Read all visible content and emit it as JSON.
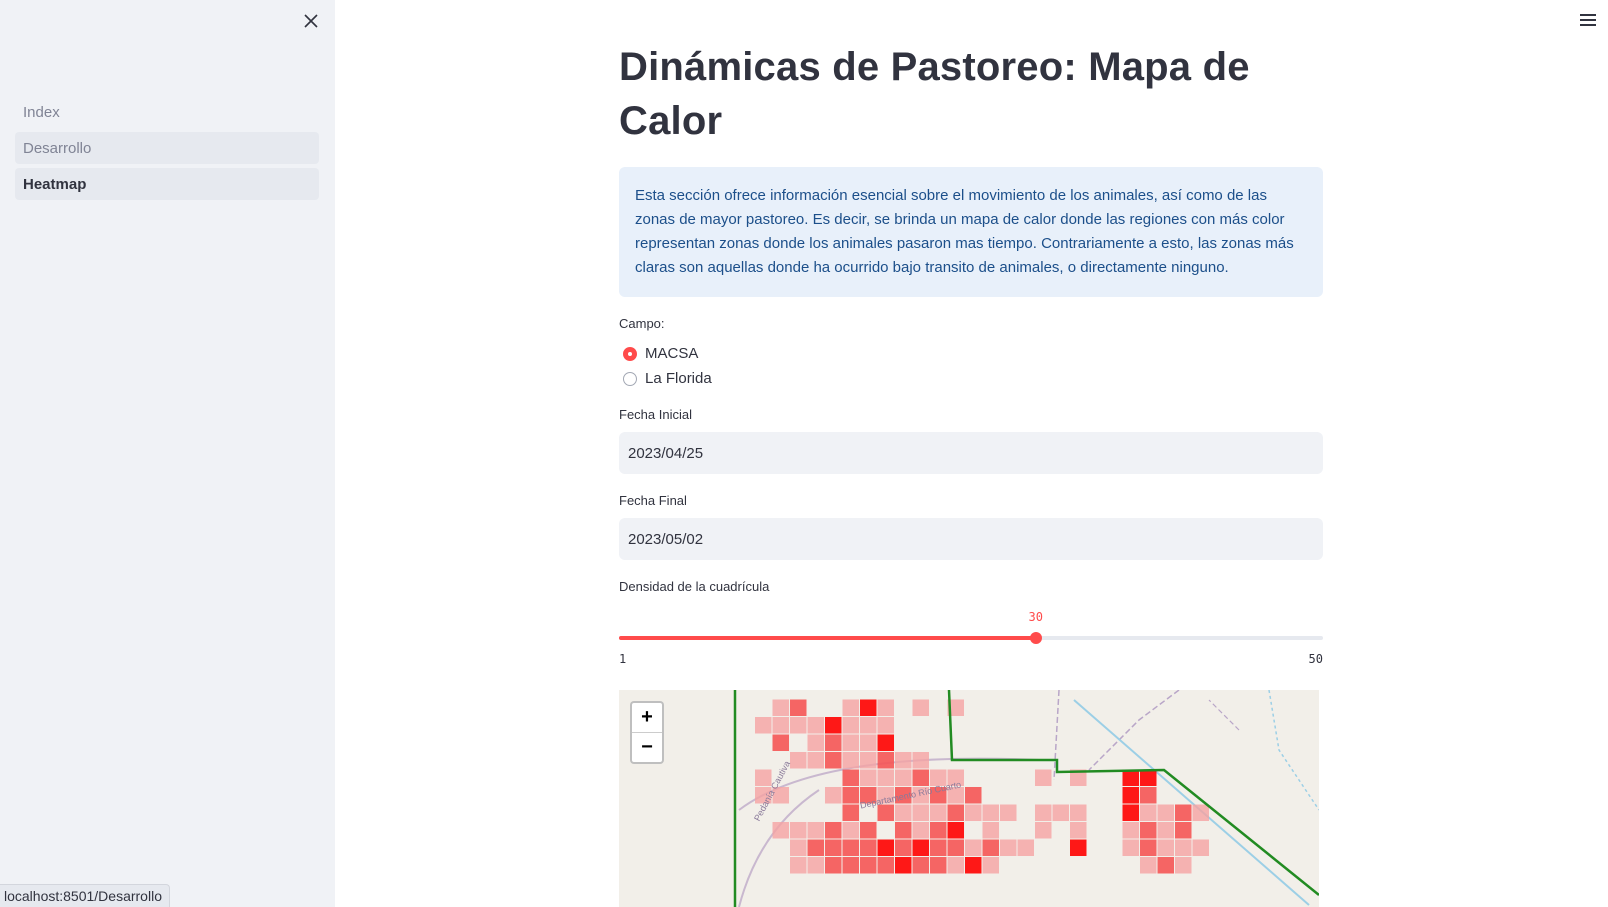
{
  "sidebar": {
    "close_icon": "close-icon",
    "items": [
      {
        "label": "Index"
      },
      {
        "label": "Desarrollo"
      },
      {
        "label": "Heatmap"
      }
    ]
  },
  "status_bar": {
    "url": "localhost:8501/Desarrollo"
  },
  "header": {
    "menu_icon": "hamburger-menu-icon"
  },
  "main": {
    "title": "Dinámicas de Pastoreo: Mapa de Calor",
    "info": "Esta sección ofrece información esencial sobre el movimiento de los animales, así como de las zonas de mayor pastoreo. Es decir, se brinda un mapa de calor donde las regiones con más color representan zonas donde los animales pasaron mas tiempo. Contrariamente a esto, las zonas más claras son aquellas donde ha ocurrido bajo transito de animales, o directamente ninguno.",
    "campo": {
      "label": "Campo:",
      "options": [
        "MACSA",
        "La Florida"
      ],
      "selected": "MACSA"
    },
    "fecha_inicial": {
      "label": "Fecha Inicial",
      "value": "2023/04/25"
    },
    "fecha_final": {
      "label": "Fecha Final",
      "value": "2023/05/02"
    },
    "densidad": {
      "label": "Densidad de la cuadrícula",
      "value": "30",
      "min": "1",
      "max": "50",
      "fraction": 0.592
    }
  },
  "map": {
    "zoom_in": "+",
    "zoom_out": "−",
    "labels": [
      "Pedanía Cautiva",
      "Departamento Río Cuarto"
    ],
    "colors": {
      "heat_high": "#ff0000",
      "heat_low": "#f5a3a3",
      "boundary": "#228b22",
      "accent": "#ff4b4b"
    }
  }
}
